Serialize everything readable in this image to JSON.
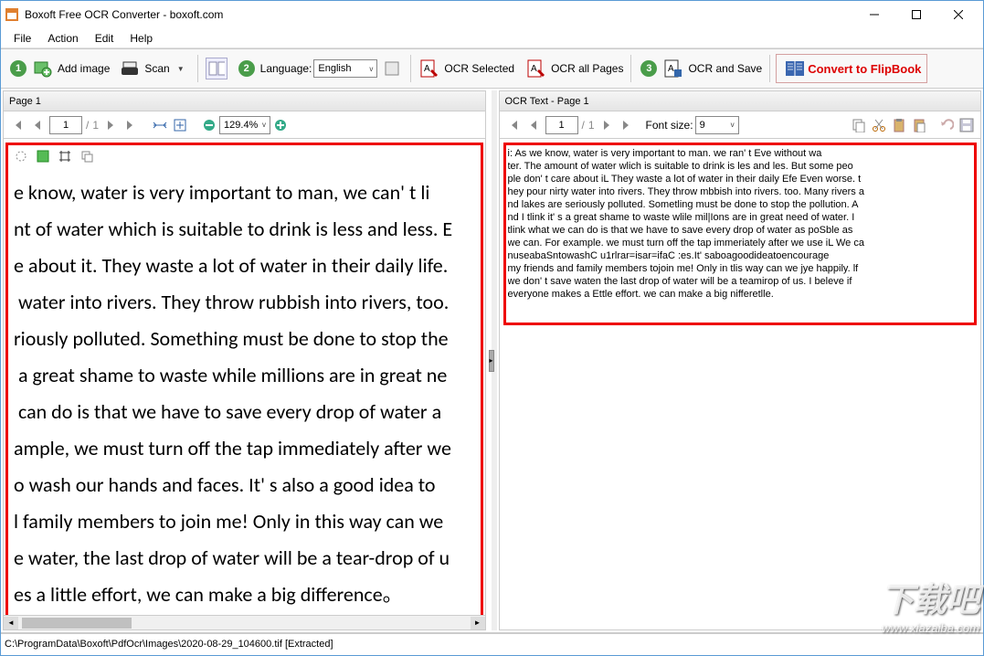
{
  "window": {
    "title": "Boxoft Free OCR Converter - boxoft.com"
  },
  "menu": {
    "file": "File",
    "action": "Action",
    "edit": "Edit",
    "help": "Help"
  },
  "toolbar": {
    "step1": "1",
    "add_image": "Add image",
    "scan": "Scan",
    "step2": "2",
    "language_label": "Language:",
    "language_value": "English",
    "ocr_selected": "OCR Selected",
    "ocr_all": "OCR all Pages",
    "step3": "3",
    "ocr_save": "OCR and Save",
    "flip": "Convert to FlipBook"
  },
  "left": {
    "tab": "Page 1",
    "page_cur": "1",
    "page_sep": "/",
    "page_total": "1",
    "zoom": "129.4%",
    "src_text": "e know, water is very important to man, we can' t li\nnt of water which is suitable to drink is less and less. E\ne about it. They waste a lot of water in their daily life. \n water into rivers. They throw rubbish into rivers, too. \nriously polluted. Something must be done to stop the\n a great shame to waste while millions are in great ne\n can do is that we have to save every drop of water a\nample, we must turn off the tap immediately after we\no wash our hands and faces. It' s also a good idea to\nl family members to join me! Only in this way can we \ne water, the last drop of water will be a tear-drop of u\nes a little effort, we can make a big difference。"
  },
  "right": {
    "tab": "OCR Text - Page 1",
    "page_cur": "1",
    "page_sep": "/",
    "page_total": "1",
    "font_label": "Font size:",
    "font_value": "9",
    "ocr_text": "i: As we know, water is very important to man. we ran' t Eve without wa\nter. The amount of water wlich is suitable to drink is les and les. But some peo\nple don' t care about iL They waste a lot of water in their daily Efe Even worse. t\nhey pour nirty water into rivers. They throw mbbish into rivers. too. Many rivers a\nnd lakes are seriously polluted. Sometling must be done to stop the pollution. A\nnd I tlink it' s a great shame to waste wlile mil|Ions are in great need of water. I\ntlink what we can do is that we have to save every drop of water as poSble as\nwe can. For example. we must turn off the tap immeriately after we use iL We ca\nnuseabaSntowashC u1rlrar=isar=ifaC :es.It' saboagoodideatoencourage\nmy friends and family members tojoin me! Only in tlis way can we jye happily. lf\nwe don' t save waten the last drop of water will be a teamirop of us. I beleve if\neveryone makes a Ettle effort. we can make a big nifferetlle."
  },
  "status": {
    "path": "C:\\ProgramData\\Boxoft\\PdfOcr\\Images\\2020-08-29_104600.tif [Extracted]"
  },
  "watermark": {
    "big": "下载吧",
    "small": "www.xiazaiba.com"
  }
}
